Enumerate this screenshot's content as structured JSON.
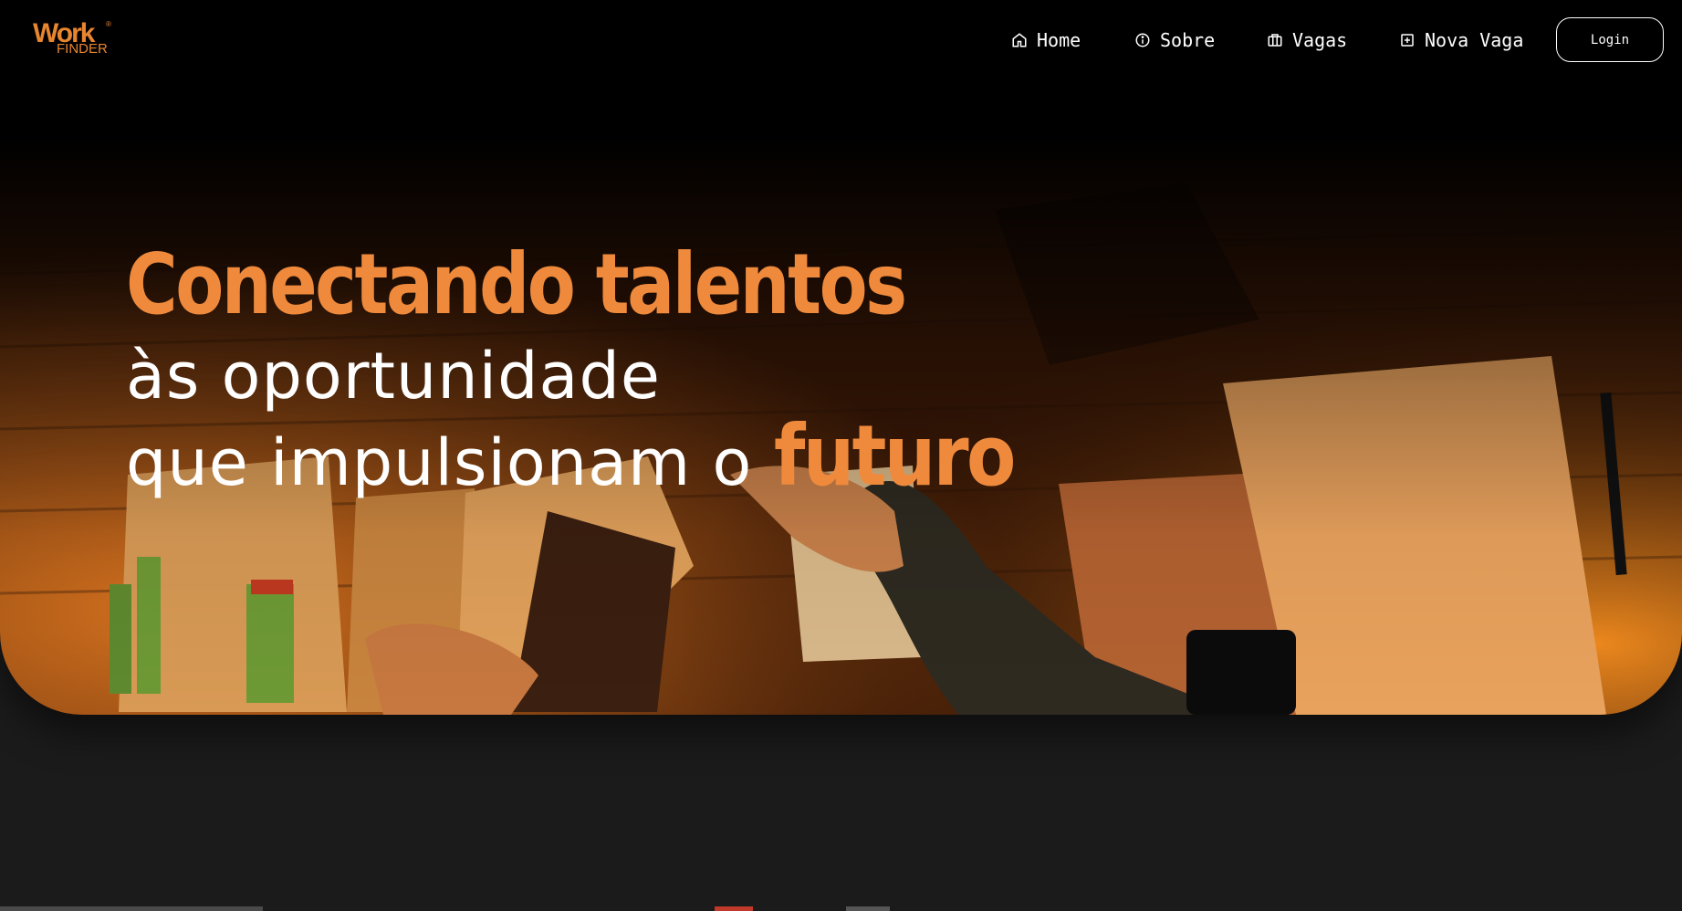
{
  "logo": {
    "word_top": "Work",
    "word_bottom": "FINDER",
    "registered": "®"
  },
  "nav": {
    "items": [
      {
        "label": "Home",
        "icon": "home-icon"
      },
      {
        "label": "Sobre",
        "icon": "info-icon"
      },
      {
        "label": "Vagas",
        "icon": "briefcase-icon"
      },
      {
        "label": "Nova Vaga",
        "icon": "plus-square-icon"
      }
    ],
    "login_label": "Login"
  },
  "hero": {
    "line1": "Conectando talentos",
    "line2": "às oportunidade",
    "line3_prefix": "que impulsionam o ",
    "line3_accent": "futuro"
  },
  "colors": {
    "accent": "#ef8a3c",
    "background": "#1b1b1b",
    "topbar": "#000000",
    "text": "#ffffff"
  }
}
